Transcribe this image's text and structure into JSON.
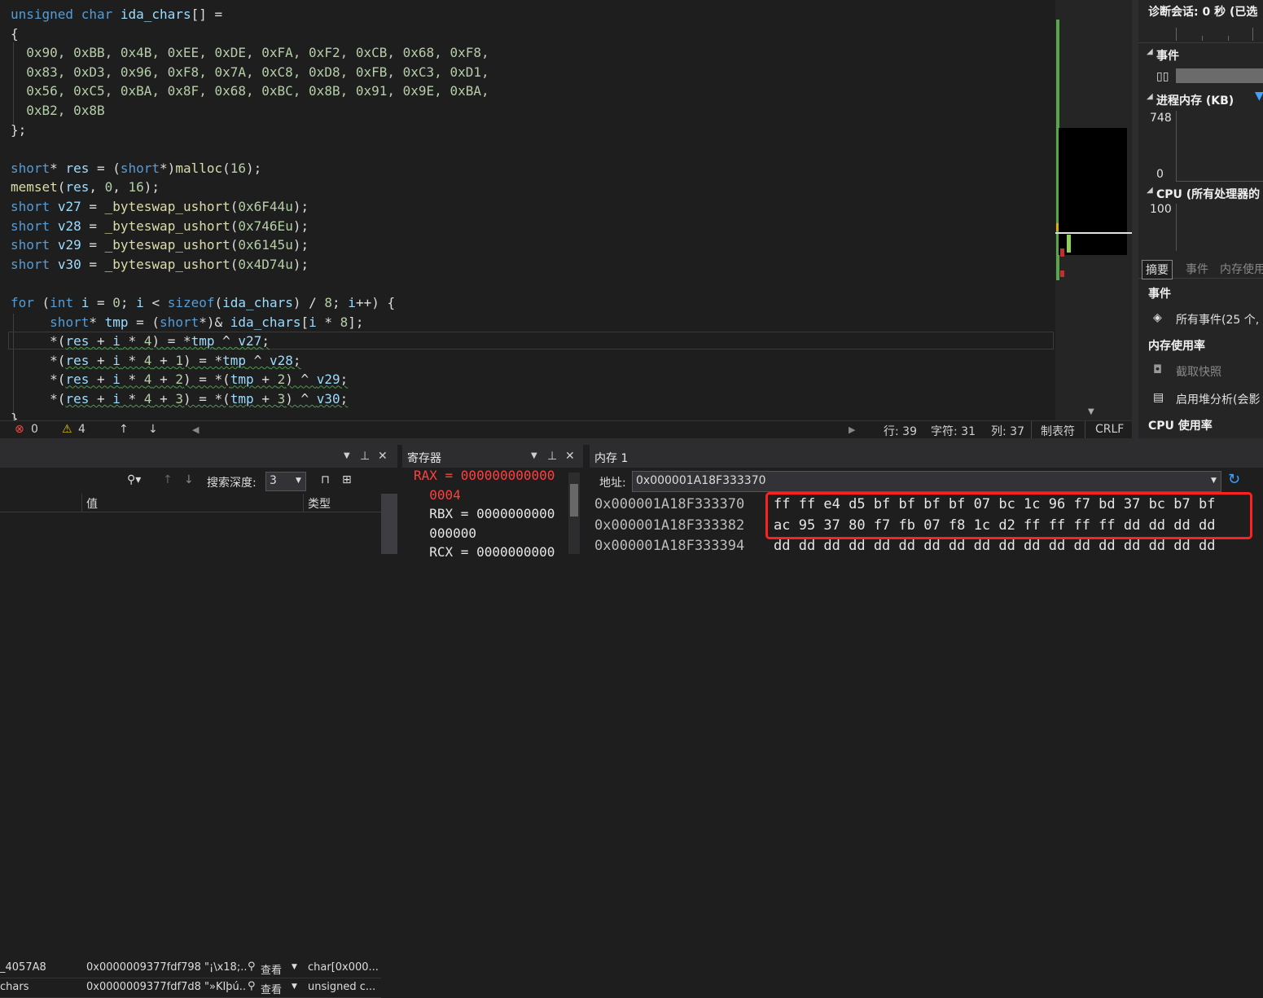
{
  "editor": {
    "lines": [
      {
        "parts": [
          [
            "kw",
            "unsigned"
          ],
          [
            "pu",
            " "
          ],
          [
            "kw",
            "char"
          ],
          [
            "pu",
            " "
          ],
          [
            "id",
            "ida_chars"
          ],
          [
            "pu",
            "[] ="
          ]
        ]
      },
      {
        "parts": [
          [
            "pu",
            "{"
          ]
        ]
      },
      {
        "parts": [
          [
            "nu",
            "  0x90, 0xBB, 0x4B, 0xEE, 0xDE, 0xFA, 0xF2, 0xCB, 0x68, 0xF8,"
          ]
        ]
      },
      {
        "parts": [
          [
            "nu",
            "  0x83, 0xD3, 0x96, 0xF8, 0x7A, 0xC8, 0xD8, 0xFB, 0xC3, 0xD1,"
          ]
        ]
      },
      {
        "parts": [
          [
            "nu",
            "  0x56, 0xC5, 0xBA, 0x8F, 0x68, 0xBC, 0x8B, 0x91, 0x9E, 0xBA,"
          ]
        ]
      },
      {
        "parts": [
          [
            "nu",
            "  0xB2, 0x8B"
          ]
        ]
      },
      {
        "parts": [
          [
            "pu",
            "};"
          ]
        ]
      },
      {
        "parts": []
      },
      {
        "parts": [
          [
            "kw",
            "short"
          ],
          [
            "pu",
            "* "
          ],
          [
            "id",
            "res"
          ],
          [
            "pu",
            " = ("
          ],
          [
            "kw",
            "short"
          ],
          [
            "pu",
            "*)"
          ],
          [
            "fn",
            "malloc"
          ],
          [
            "pu",
            "("
          ],
          [
            "nu",
            "16"
          ],
          [
            "pu",
            ");"
          ]
        ]
      },
      {
        "parts": [
          [
            "fn",
            "memset"
          ],
          [
            "pu",
            "("
          ],
          [
            "id",
            "res"
          ],
          [
            "pu",
            ", "
          ],
          [
            "nu",
            "0"
          ],
          [
            "pu",
            ", "
          ],
          [
            "nu",
            "16"
          ],
          [
            "pu",
            ");"
          ]
        ]
      },
      {
        "parts": [
          [
            "kw",
            "short"
          ],
          [
            "pu",
            " "
          ],
          [
            "id",
            "v27"
          ],
          [
            "pu",
            " = "
          ],
          [
            "fn",
            "_byteswap_ushort"
          ],
          [
            "pu",
            "("
          ],
          [
            "nu",
            "0x6F44u"
          ],
          [
            "pu",
            ");"
          ]
        ]
      },
      {
        "parts": [
          [
            "kw",
            "short"
          ],
          [
            "pu",
            " "
          ],
          [
            "id",
            "v28"
          ],
          [
            "pu",
            " = "
          ],
          [
            "fn",
            "_byteswap_ushort"
          ],
          [
            "pu",
            "("
          ],
          [
            "nu",
            "0x746Eu"
          ],
          [
            "pu",
            ");"
          ]
        ]
      },
      {
        "parts": [
          [
            "kw",
            "short"
          ],
          [
            "pu",
            " "
          ],
          [
            "id",
            "v29"
          ],
          [
            "pu",
            " = "
          ],
          [
            "fn",
            "_byteswap_ushort"
          ],
          [
            "pu",
            "("
          ],
          [
            "nu",
            "0x6145u"
          ],
          [
            "pu",
            ");"
          ]
        ]
      },
      {
        "parts": [
          [
            "kw",
            "short"
          ],
          [
            "pu",
            " "
          ],
          [
            "id",
            "v30"
          ],
          [
            "pu",
            " = "
          ],
          [
            "fn",
            "_byteswap_ushort"
          ],
          [
            "pu",
            "("
          ],
          [
            "nu",
            "0x4D74u"
          ],
          [
            "pu",
            ");"
          ]
        ]
      },
      {
        "parts": []
      },
      {
        "parts": [
          [
            "kw",
            "for"
          ],
          [
            "pu",
            " ("
          ],
          [
            "kw",
            "int"
          ],
          [
            "pu",
            " "
          ],
          [
            "id",
            "i"
          ],
          [
            "pu",
            " = "
          ],
          [
            "nu",
            "0"
          ],
          [
            "pu",
            "; "
          ],
          [
            "id",
            "i"
          ],
          [
            "pu",
            " < "
          ],
          [
            "kw",
            "sizeof"
          ],
          [
            "pu",
            "("
          ],
          [
            "id",
            "ida_chars"
          ],
          [
            "pu",
            ") / "
          ],
          [
            "nu",
            "8"
          ],
          [
            "pu",
            "; "
          ],
          [
            "id",
            "i"
          ],
          [
            "pu",
            "++) {"
          ]
        ]
      },
      {
        "parts": [
          [
            "pu",
            "     "
          ],
          [
            "kw",
            "short"
          ],
          [
            "pu",
            "* "
          ],
          [
            "id",
            "tmp"
          ],
          [
            "pu",
            " = ("
          ],
          [
            "kw",
            "short"
          ],
          [
            "pu",
            "*)& "
          ],
          [
            "id",
            "ida_chars"
          ],
          [
            "pu",
            "["
          ],
          [
            "id",
            "i"
          ],
          [
            "pu",
            " * "
          ],
          [
            "nu",
            "8"
          ],
          [
            "pu",
            "];"
          ]
        ]
      },
      {
        "parts": [
          [
            "pu",
            "     *("
          ],
          [
            "id",
            "res"
          ],
          [
            "pu",
            " + "
          ],
          [
            "id",
            "i"
          ],
          [
            "pu",
            " * "
          ],
          [
            "nu",
            "4"
          ],
          [
            "pu",
            ") = *"
          ],
          [
            "id",
            "tmp"
          ],
          [
            "pu",
            " ^ "
          ],
          [
            "id",
            "v27"
          ],
          [
            "pu",
            ";"
          ]
        ]
      },
      {
        "parts": [
          [
            "pu",
            "     *("
          ],
          [
            "id",
            "res"
          ],
          [
            "pu",
            " + "
          ],
          [
            "id",
            "i"
          ],
          [
            "pu",
            " * "
          ],
          [
            "nu",
            "4"
          ],
          [
            "pu",
            " + "
          ],
          [
            "nu",
            "1"
          ],
          [
            "pu",
            ") = *"
          ],
          [
            "id",
            "tmp"
          ],
          [
            "pu",
            " ^ "
          ],
          [
            "id",
            "v28"
          ],
          [
            "pu",
            ";"
          ]
        ]
      },
      {
        "parts": [
          [
            "pu",
            "     *("
          ],
          [
            "id",
            "res"
          ],
          [
            "pu",
            " + "
          ],
          [
            "id",
            "i"
          ],
          [
            "pu",
            " * "
          ],
          [
            "nu",
            "4"
          ],
          [
            "pu",
            " + "
          ],
          [
            "nu",
            "2"
          ],
          [
            "pu",
            ") = *("
          ],
          [
            "id",
            "tmp"
          ],
          [
            "pu",
            " + "
          ],
          [
            "nu",
            "2"
          ],
          [
            "pu",
            ") ^ "
          ],
          [
            "id",
            "v29"
          ],
          [
            "pu",
            ";"
          ]
        ]
      },
      {
        "parts": [
          [
            "pu",
            "     *("
          ],
          [
            "id",
            "res"
          ],
          [
            "pu",
            " + "
          ],
          [
            "id",
            "i"
          ],
          [
            "pu",
            " * "
          ],
          [
            "nu",
            "4"
          ],
          [
            "pu",
            " + "
          ],
          [
            "nu",
            "3"
          ],
          [
            "pu",
            ") = *("
          ],
          [
            "id",
            "tmp"
          ],
          [
            "pu",
            " + "
          ],
          [
            "nu",
            "3"
          ],
          [
            "pu",
            ") ^ "
          ],
          [
            "id",
            "v30"
          ],
          [
            "pu",
            ";"
          ]
        ]
      },
      {
        "parts": [
          [
            "pu",
            "}"
          ]
        ]
      }
    ]
  },
  "status": {
    "errors": "0",
    "warnings": "4",
    "line": "行: 39",
    "char": "字符: 31",
    "col": "列: 37",
    "tabs": "制表符",
    "eol": "CRLF"
  },
  "diag": {
    "session": "诊断会话: 0 秒 (已选",
    "events_h": "事件",
    "mem_h": "进程内存 (KB)",
    "mem_max": "748",
    "mem_min": "0",
    "cpu_h": "CPU (所有处理器的",
    "cpu_max": "100",
    "tab_summary": "摘要",
    "tab_events": "事件",
    "tab_mem": "内存使用",
    "sec_events": "事件",
    "all_events": "所有事件(25 个,",
    "sec_mem": "内存使用率",
    "snapshot": "截取快照",
    "heap": "启用堆分析(会影",
    "sec_cpu": "CPU 使用率"
  },
  "watch": {
    "search_depth_label": "搜索深度:",
    "search_depth_value": "3",
    "col_value": "值",
    "col_type": "类型",
    "rows": [
      {
        "name": "_4057A8",
        "value": "0x0000009377fdf798 \"¡\\x18;...",
        "view": "查看",
        "type": "char[0x000..."
      },
      {
        "name": "chars",
        "value": "0x0000009377fdf7d8 \"»KÎþú...",
        "view": "查看",
        "type": "unsigned c..."
      }
    ]
  },
  "registers": {
    "title": "寄存器",
    "lines": [
      {
        "text": "RAX = 000000000000",
        "color": "#ff4040",
        "name": "RAX"
      },
      {
        "text": "  0004",
        "color": "#ff4040",
        "name": "RAX-cont"
      },
      {
        "text": "  RBX = 0000000000",
        "color": "#e6e6e6",
        "name": "RBX"
      },
      {
        "text": "  000000",
        "color": "#e6e6e6",
        "name": "RBX-cont"
      },
      {
        "text": "  RCX = 0000000000",
        "color": "#e6e6e6",
        "name": "RCX"
      }
    ]
  },
  "memory": {
    "title": "内存 1",
    "address_label": "地址:",
    "address_value": "0x000001A18F333370",
    "rows": [
      {
        "addr": "0x000001A18F333370",
        "bytes": "ff ff e4 d5 bf bf bf bf 07 bc 1c 96 f7 bd 37 bc b7 bf"
      },
      {
        "addr": "0x000001A18F333382",
        "bytes": "ac 95 37 80 f7 fb 07 f8 1c d2 ff ff ff ff dd dd dd dd"
      },
      {
        "addr": "0x000001A18F333394",
        "bytes": "dd dd dd dd dd dd dd dd dd dd dd dd dd dd dd dd dd dd"
      }
    ]
  }
}
